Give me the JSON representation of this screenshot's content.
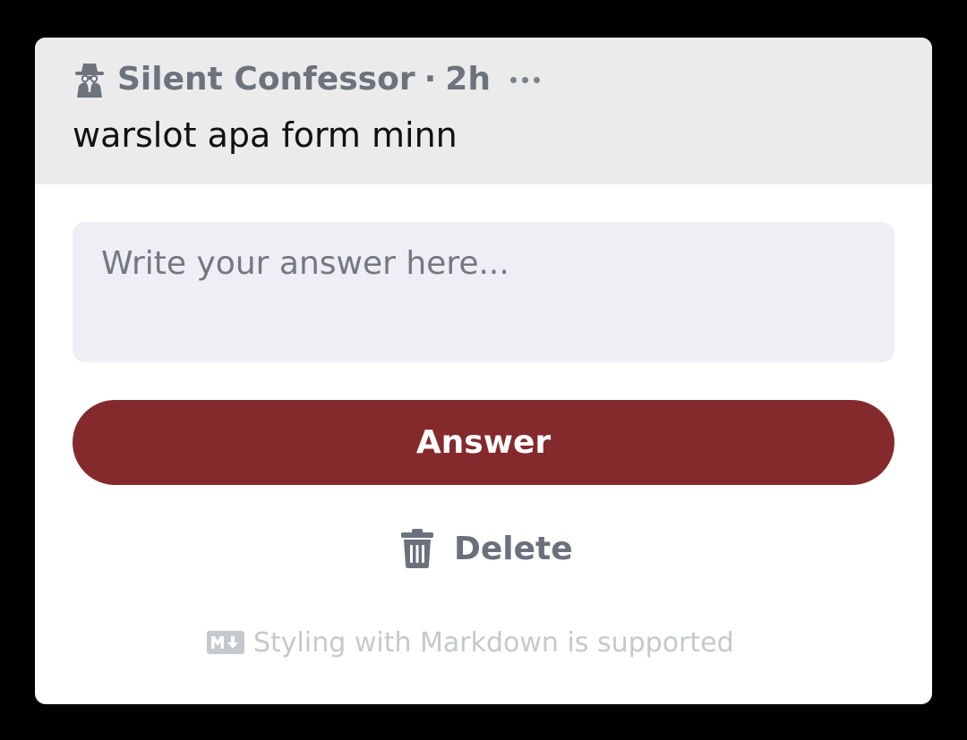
{
  "post": {
    "author": "Silent Confessor",
    "separator": "·",
    "time_ago": "2h",
    "text": "warslot apa form minn"
  },
  "answer": {
    "placeholder": "Write your answer here...",
    "value": "",
    "button_label": "Answer"
  },
  "actions": {
    "delete_label": "Delete"
  },
  "footer": {
    "markdown_note": "Styling with Markdown is supported"
  },
  "colors": {
    "background": "#000000",
    "header_bg": "#ebebec",
    "input_bg": "#efeef4",
    "accent": "#842a2d",
    "muted_text": "#6c737d",
    "note_text": "#c5c8cd"
  },
  "icons": {
    "author": "incognito-spy-icon",
    "more": "ellipsis-icon",
    "delete": "trash-icon",
    "markdown": "markdown-icon"
  }
}
